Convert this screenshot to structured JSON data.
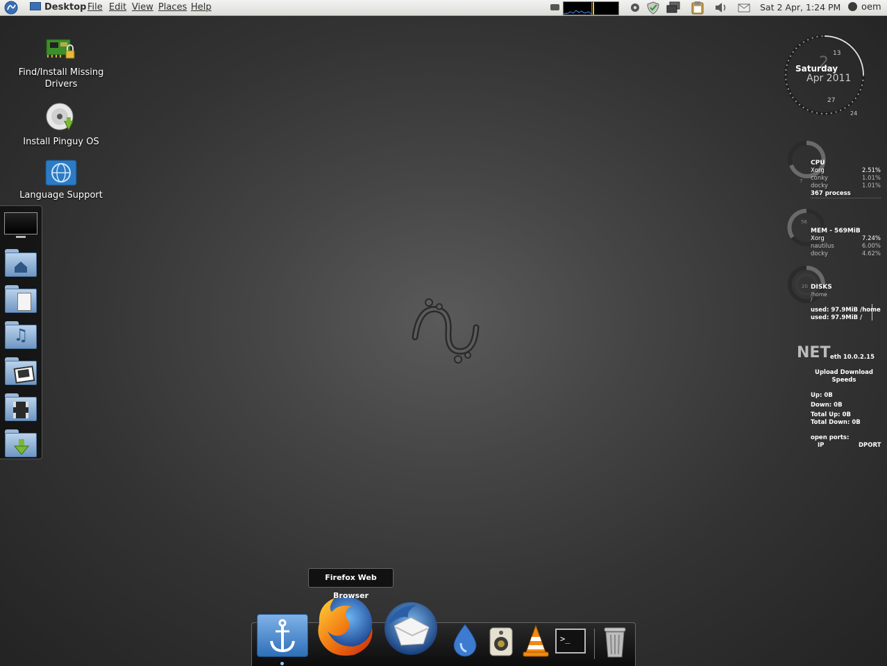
{
  "top_panel": {
    "app_label": "Desktop",
    "menus": [
      "File",
      "Edit",
      "View",
      "Places",
      "Help"
    ],
    "clock": "Sat  2 Apr,  1:24 PM",
    "user": "oem"
  },
  "desktop_icons": [
    {
      "label": "Find/Install Missing Drivers"
    },
    {
      "label": "Install Pinguy OS"
    },
    {
      "label": "Language Support"
    }
  ],
  "conky": {
    "date": {
      "day_number": "2",
      "weekday": "Saturday",
      "month_year": "Apr 2011",
      "tick_13": "13",
      "tick_27": "27",
      "tick_24": "24"
    },
    "cpu": {
      "title": "CPU",
      "procs": [
        {
          "name": "Xorg",
          "value": "2.51%"
        },
        {
          "name": "conky",
          "value": "1.01%"
        },
        {
          "name": "docky",
          "value": "1.01%"
        }
      ],
      "process_count": "367 process",
      "gauge": "7"
    },
    "mem": {
      "title": "MEM - 569MiB",
      "procs": [
        {
          "name": "Xorg",
          "value": "7.24%"
        },
        {
          "name": "nautilus",
          "value": "6.00%"
        },
        {
          "name": "docky",
          "value": "4.62%"
        }
      ],
      "gauge": "56"
    },
    "disks": {
      "title": "DISKS",
      "mounts": [
        "/home",
        "/"
      ],
      "used": [
        "used: 97.9MiB /home",
        "used: 97.9MiB /"
      ],
      "gauge": "20"
    },
    "net": {
      "big": "NET",
      "iface": "eth 10.0.2.15",
      "header": "Upload Download Speeds",
      "up": "Up: 0B",
      "down": "Down: 0B",
      "total_up": "Total Up: 0B",
      "total_down": "Total Down: 0B",
      "ports_title": "open ports:",
      "ip_col": "IP",
      "dport_col": "DPORT"
    }
  },
  "dock": {
    "tooltip": "Firefox Web Browser",
    "items": [
      "docky-anchor-icon",
      "firefox-icon",
      "thunderbird-icon",
      "deluge-icon",
      "speaker-icon",
      "vlc-icon",
      "terminal-icon",
      "trash-icon"
    ]
  }
}
